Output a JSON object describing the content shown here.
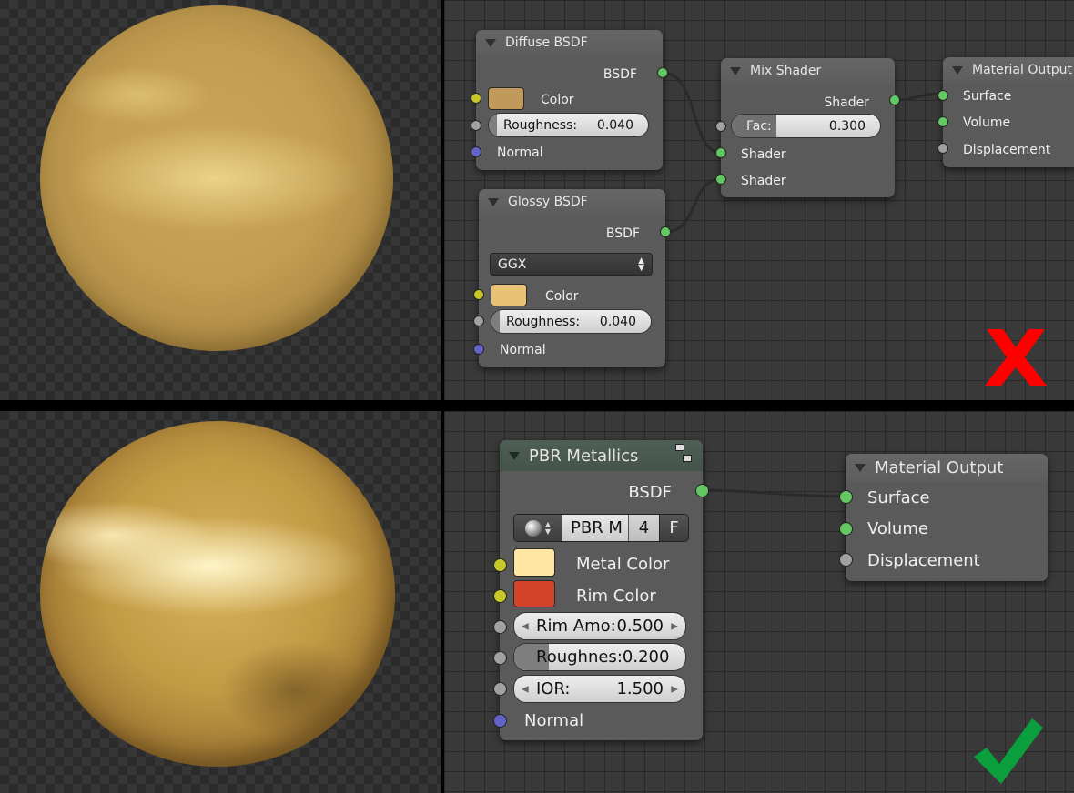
{
  "top": {
    "diffuse": {
      "title": "Diffuse BSDF",
      "output": "BSDF",
      "color_label": "Color",
      "color_value": "#c09a5a",
      "roughness_label": "Roughness:",
      "roughness_value": "0.040",
      "normal_label": "Normal"
    },
    "glossy": {
      "title": "Glossy BSDF",
      "output": "BSDF",
      "distribution": "GGX",
      "color_label": "Color",
      "color_value": "#e9c275",
      "roughness_label": "Roughness:",
      "roughness_value": "0.040",
      "normal_label": "Normal"
    },
    "mix": {
      "title": "Mix Shader",
      "output": "Shader",
      "fac_label": "Fac:",
      "fac_value": "0.300",
      "fac_fraction": 0.3,
      "input1": "Shader",
      "input2": "Shader"
    },
    "output": {
      "title": "Material Output",
      "surface": "Surface",
      "volume": "Volume",
      "displacement": "Displacement"
    },
    "verdict_icon": "cross-icon",
    "verdict_color": "#ff0000"
  },
  "bottom": {
    "pbr": {
      "title": "PBR Metallics",
      "output": "BSDF",
      "group_name": "PBR M",
      "user_count": "4",
      "fake_user": "F",
      "metal_color_label": "Metal Color",
      "metal_color_value": "#ffe7a3",
      "rim_color_label": "Rim Color",
      "rim_color_value": "#d2432a",
      "rim_label": "Rim Amo:",
      "rim_value": "0.500",
      "roughness_label": "Roughnes:",
      "roughness_value": "0.200",
      "roughness_fraction": 0.2,
      "ior_label": "IOR:",
      "ior_value": "1.500",
      "normal_label": "Normal"
    },
    "output": {
      "title": "Material Output",
      "surface": "Surface",
      "volume": "Volume",
      "displacement": "Displacement"
    },
    "verdict_icon": "checkmark-icon",
    "verdict_color": "#0a9e3c"
  }
}
